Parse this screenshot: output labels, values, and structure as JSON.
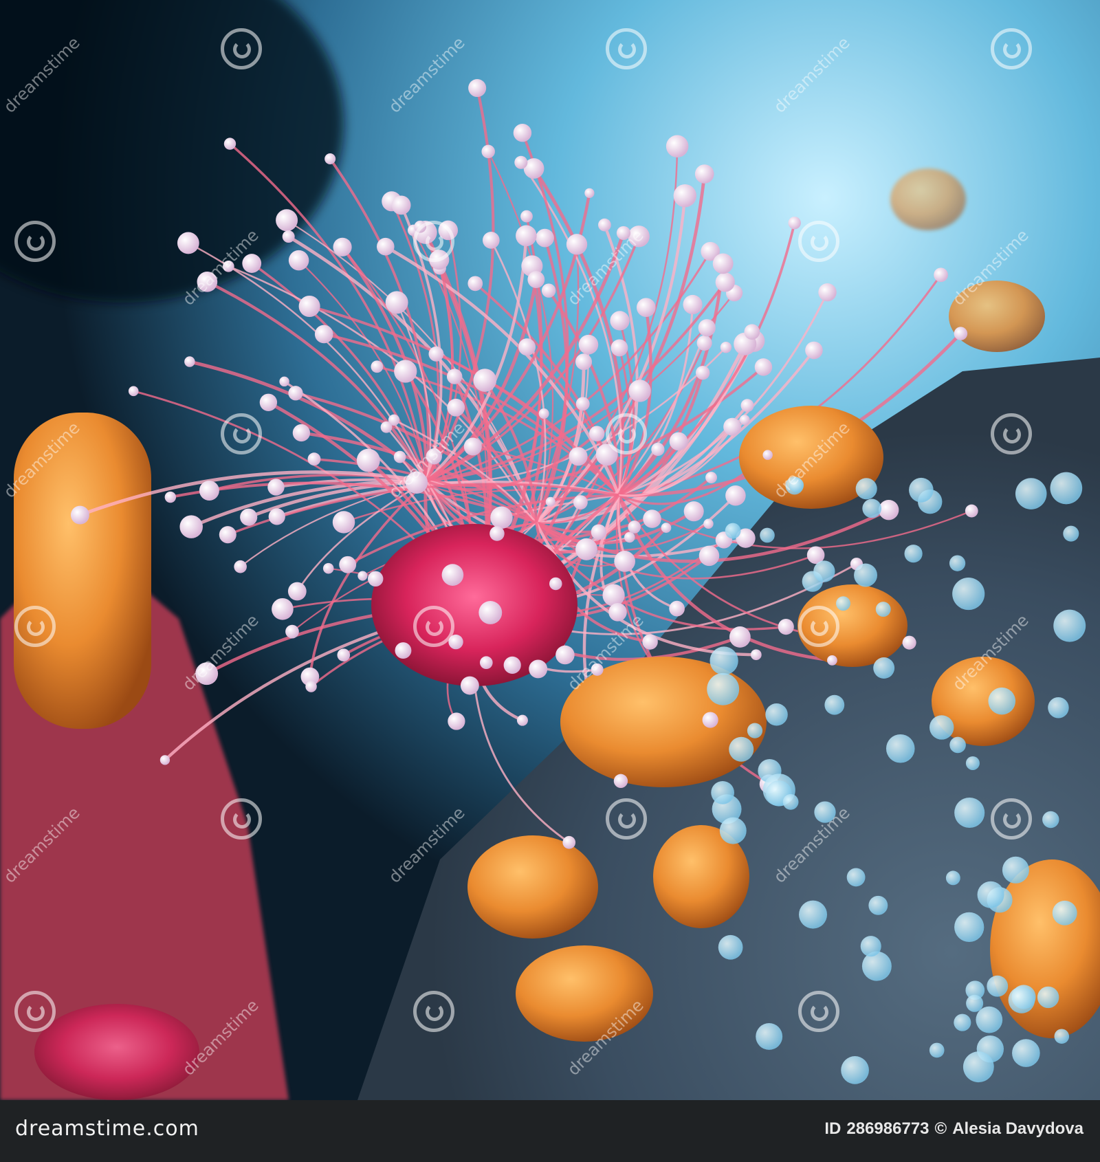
{
  "image": {
    "subject": "microscopic-cells",
    "palette": {
      "background_blue": "#5fb6dc",
      "pink": "#f04c78",
      "orange": "#e6882d",
      "slate": "#4f6477"
    }
  },
  "watermark": {
    "text": "dreamstime"
  },
  "footer": {
    "logo": "dreamstime.com",
    "id_label": "ID",
    "id_value": "286986773",
    "copyright_symbol": "©",
    "author": "Alesia Davydova"
  }
}
